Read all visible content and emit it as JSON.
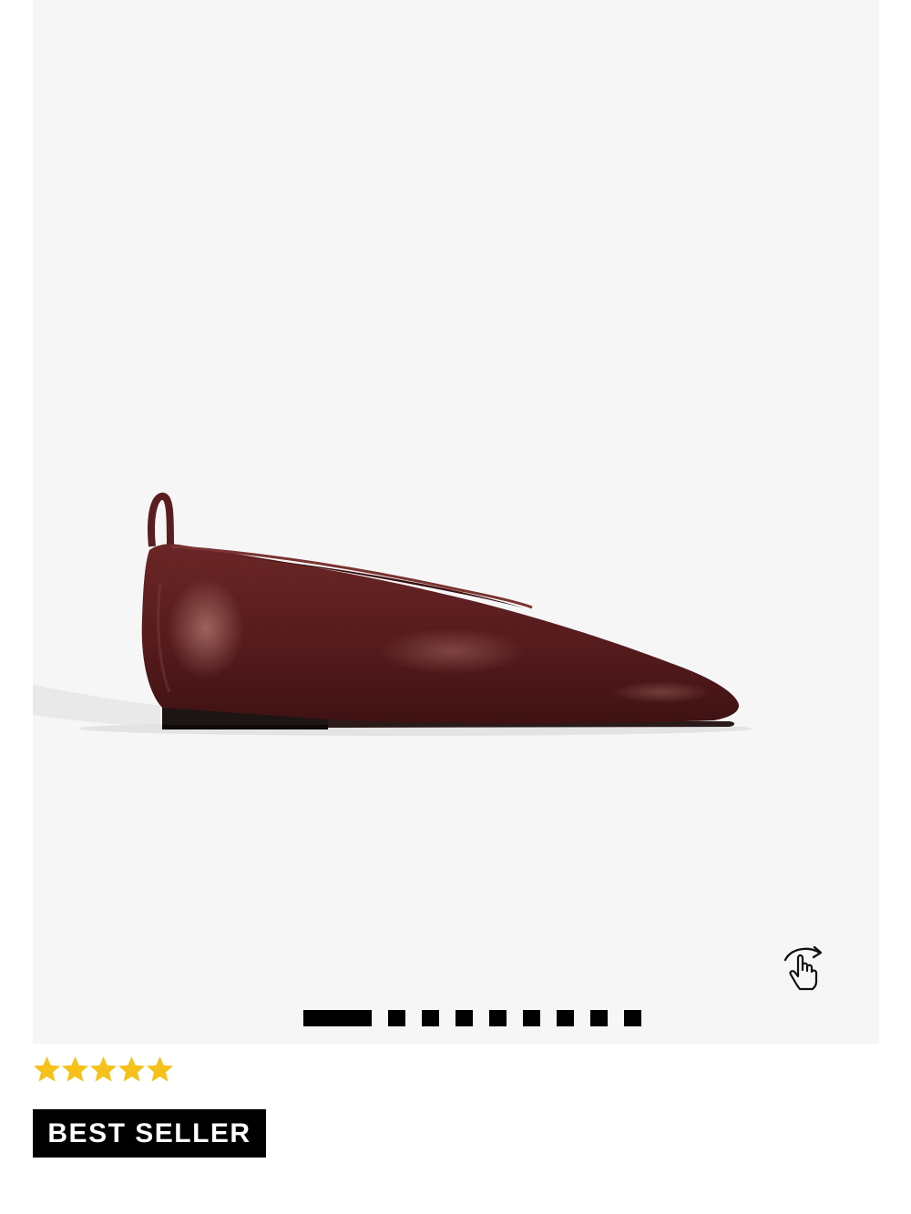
{
  "product": {
    "image_name": "burgundy-leather-ballet-flat"
  },
  "gallery": {
    "total_images": 9,
    "active_index": 0,
    "rotate_icon": "touch-rotate-icon"
  },
  "rating": {
    "stars": 5,
    "max": 5,
    "star_color": "#f5c11a"
  },
  "badge": {
    "label": "BEST SELLER"
  },
  "colors": {
    "gallery_bg": "#f6f6f6",
    "shoe": "#5a1e1f",
    "accent": "#000000"
  }
}
